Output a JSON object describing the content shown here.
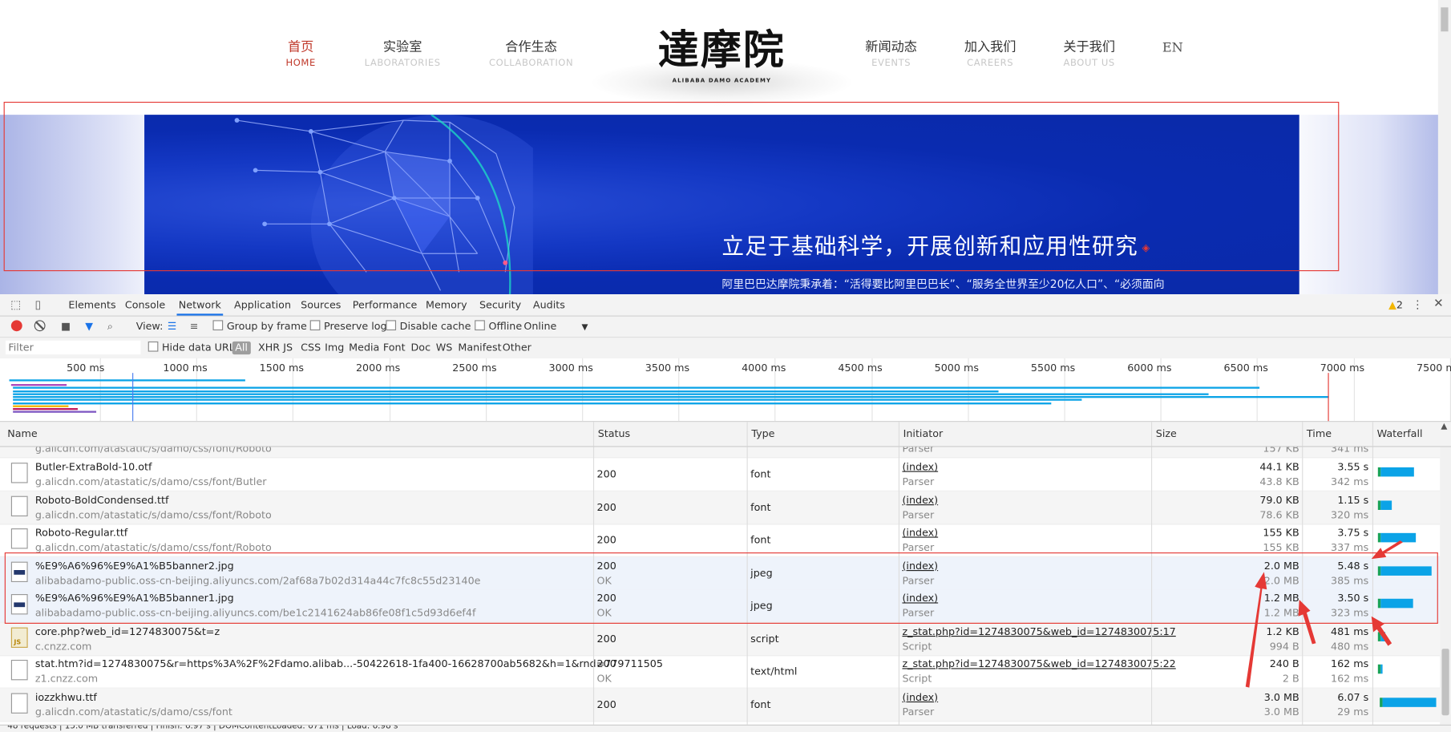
{
  "site": {
    "nav_left": [
      {
        "cn": "首页",
        "en": "HOME",
        "active": true
      },
      {
        "cn": "实验室",
        "en": "LABORATORIES"
      },
      {
        "cn": "合作生态",
        "en": "COLLABORATION"
      }
    ],
    "nav_right": [
      {
        "cn": "新闻动态",
        "en": "EVENTS"
      },
      {
        "cn": "加入我们",
        "en": "CAREERS"
      },
      {
        "cn": "关于我们",
        "en": "ABOUT US"
      }
    ],
    "lang_switch": "EN",
    "logo_cn": "達摩院",
    "logo_en": "ALIBABA DAMO ACADEMY",
    "banner_title": "立足于基础科学，开展创新和应用性研究",
    "banner_subtitle": "阿里巴巴达摩院秉承着：“活得要比阿里巴巴长”、“服务全世界至少20亿人口”、“必须面向"
  },
  "devtools": {
    "tabs": [
      "Elements",
      "Console",
      "Network",
      "Application",
      "Sources",
      "Performance",
      "Memory",
      "Security",
      "Audits"
    ],
    "active_tab": "Network",
    "warning_count": "2",
    "toolbar": {
      "view_label": "View:",
      "group_by_frame": "Group by frame",
      "preserve_log": "Preserve log",
      "disable_cache": "Disable cache",
      "offline": "Offline",
      "throttle": "Online"
    },
    "filter_placeholder": "Filter",
    "hide_data_urls": "Hide data URLs",
    "type_filters": [
      "All",
      "XHR",
      "JS",
      "CSS",
      "Img",
      "Media",
      "Font",
      "Doc",
      "WS",
      "Manifest",
      "Other"
    ],
    "overview_ticks": [
      "500 ms",
      "1000 ms",
      "1500 ms",
      "2000 ms",
      "2500 ms",
      "3000 ms",
      "3500 ms",
      "4000 ms",
      "4500 ms",
      "5000 ms",
      "5500 ms",
      "6000 ms",
      "6500 ms",
      "7000 ms",
      "7500 ms"
    ],
    "columns": [
      "Name",
      "Status",
      "Type",
      "Initiator",
      "Size",
      "Time",
      "Waterfall"
    ],
    "partial_row": {
      "name2": "g.alicdn.com/atastatic/s/damo/css/font/Roboto",
      "init2": "Parser",
      "size2": "157 KB",
      "time2": "341 ms"
    },
    "rows": [
      {
        "name": "Butler-ExtraBold-10.otf",
        "domain": "g.alicdn.com/atastatic/s/damo/css/font/Butler",
        "status": "200",
        "status_text": "",
        "type": "font",
        "initiator": "(index)",
        "initiator_type": "Parser",
        "size": "44.1 KB",
        "size2": "43.8 KB",
        "time": "3.55 s",
        "latency": "342 ms",
        "wf_start": 0.05,
        "wf_dur": 0.56,
        "icon": "file"
      },
      {
        "name": "Roboto-BoldCondensed.ttf",
        "domain": "g.alicdn.com/atastatic/s/damo/css/font/Roboto",
        "status": "200",
        "status_text": "",
        "type": "font",
        "initiator": "(index)",
        "initiator_type": "Parser",
        "size": "79.0 KB",
        "size2": "78.6 KB",
        "time": "1.15 s",
        "latency": "320 ms",
        "wf_start": 0.05,
        "wf_dur": 0.18,
        "icon": "file"
      },
      {
        "name": "Roboto-Regular.ttf",
        "domain": "g.alicdn.com/atastatic/s/damo/css/font/Roboto",
        "status": "200",
        "status_text": "",
        "type": "font",
        "initiator": "(index)",
        "initiator_type": "Parser",
        "size": "155 KB",
        "size2": "155 KB",
        "time": "3.75 s",
        "latency": "337 ms",
        "wf_start": 0.05,
        "wf_dur": 0.59,
        "icon": "file"
      },
      {
        "name": "%E9%A6%96%E9%A1%B5banner2.jpg",
        "domain": "alibabadamo-public.oss-cn-beijing.aliyuncs.com/2af68a7b02d314a44c7fc8c55d23140e",
        "status": "200",
        "status_text": "OK",
        "type": "jpeg",
        "initiator": "(index)",
        "initiator_type": "Parser",
        "size": "2.0 MB",
        "size2": "2.0 MB",
        "time": "5.48 s",
        "latency": "385 ms",
        "wf_start": 0.05,
        "wf_dur": 0.86,
        "icon": "img",
        "selected": true
      },
      {
        "name": "%E9%A6%96%E9%A1%B5banner1.jpg",
        "domain": "alibabadamo-public.oss-cn-beijing.aliyuncs.com/be1c2141624ab86fe08f1c5d93d6ef4f",
        "status": "200",
        "status_text": "OK",
        "type": "jpeg",
        "initiator": "(index)",
        "initiator_type": "Parser",
        "size": "1.2 MB",
        "size2": "1.2 MB",
        "time": "3.50 s",
        "latency": "323 ms",
        "wf_start": 0.05,
        "wf_dur": 0.55,
        "icon": "img",
        "selected": true
      },
      {
        "name": "core.php?web_id=1274830075&t=z",
        "domain": "c.cnzz.com",
        "status": "200",
        "status_text": "",
        "type": "script",
        "initiator": "z_stat.php?id=1274830075&web_id=1274830075:17",
        "initiator_type": "Script",
        "size": "1.2 KB",
        "size2": "994 B",
        "time": "481 ms",
        "latency": "480 ms",
        "wf_start": 0.05,
        "wf_dur": 0.07,
        "icon": "js"
      },
      {
        "name": "stat.htm?id=1274830075&r=https%3A%2F%2Fdamo.alibab...-50422618-1fa400-16628700ab5682&h=1&rnd=779711505",
        "domain": "z1.cnzz.com",
        "status": "200",
        "status_text": "OK",
        "type": "text/html",
        "initiator": "z_stat.php?id=1274830075&web_id=1274830075:22",
        "initiator_type": "Script",
        "size": "240 B",
        "size2": "2 B",
        "time": "162 ms",
        "latency": "162 ms",
        "wf_start": 0.05,
        "wf_dur": 0.03,
        "icon": "file"
      },
      {
        "name": "iozzkhwu.ttf",
        "domain": "g.alicdn.com/atastatic/s/damo/css/font",
        "status": "200",
        "status_text": "",
        "type": "font",
        "initiator": "(index)",
        "initiator_type": "Parser",
        "size": "3.0 MB",
        "size2": "3.0 MB",
        "time": "6.07 s",
        "latency": "29 ms",
        "wf_start": 0.08,
        "wf_dur": 0.9,
        "icon": "file"
      }
    ],
    "summary": "48 requests | 15.0 MB transferred | Finish: 6.97 s | DOMContentLoaded: 671 ms | Load: 6.98 s"
  },
  "colors": {
    "accent_red": "#e53935",
    "devtools_blue": "#1a73e8",
    "banner_blue": "#0a2bb0",
    "waterfall_bar": "#0ba3e7"
  }
}
